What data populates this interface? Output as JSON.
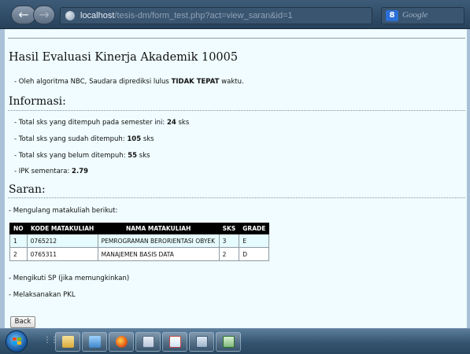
{
  "browser": {
    "url_host": "localhost",
    "url_path": "/tesis-dm/form_test.php?act=view_saran&id=1",
    "search_placeholder": "Google",
    "search_logo": "8"
  },
  "page": {
    "title": "Hasil Evaluasi Kinerja Akademik 10005",
    "prediction": {
      "prefix": "- Oleh algoritma NBC, Saudara diprediksi lulus ",
      "result": "TIDAK TEPAT",
      "suffix": " waktu."
    },
    "info": {
      "heading": "Informasi:",
      "lines": [
        {
          "label": "- Total sks yang ditempuh pada semester ini: ",
          "value": "24",
          "unit": " sks"
        },
        {
          "label": "- Total sks yang sudah ditempuh: ",
          "value": "105",
          "unit": " sks"
        },
        {
          "label": "- Total sks yang belum ditempuh: ",
          "value": "55",
          "unit": " sks"
        },
        {
          "label": "- IPK sementara: ",
          "value": "2.79",
          "unit": ""
        }
      ]
    },
    "saran": {
      "heading": "Saran:",
      "intro": "- Mengulang matakuliah berikut:",
      "table": {
        "headers": [
          "NO",
          "KODE MATAKULIAH",
          "NAMA MATAKULIAH",
          "SKS",
          "GRADE"
        ],
        "rows": [
          [
            "1",
            "0765212",
            "PEMROGRAMAN BERORIENTASI OBYEK",
            "3",
            "E"
          ],
          [
            "2",
            "0765311",
            "MANAJEMEN BASIS DATA",
            "2",
            "D"
          ]
        ]
      },
      "items": [
        "- Mengikuti SP (jika memungkinkan)",
        "- Melaksanakan PKL"
      ]
    },
    "back_label": "Back"
  },
  "taskbar": {
    "buttons": [
      "explorer-icon",
      "firefox-icon",
      "word-icon",
      "paint-icon",
      "calculator-icon",
      "excel-icon"
    ]
  },
  "colors": {
    "page_bg": "#f0fcff",
    "table_header_bg": "#000000",
    "taskbar": "#34546f"
  }
}
